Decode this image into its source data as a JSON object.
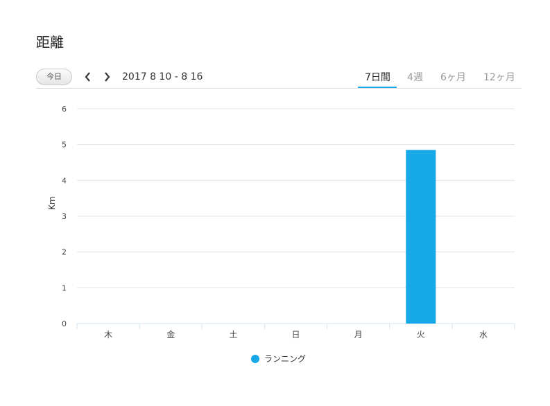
{
  "header": {
    "title": "距離"
  },
  "toolbar": {
    "today_label": "今日",
    "date_range": "2017 8 10 - 8 16",
    "tabs": [
      {
        "label": "7日間",
        "active": true
      },
      {
        "label": "4週",
        "active": false
      },
      {
        "label": "6ヶ月",
        "active": false
      },
      {
        "label": "12ヶ月",
        "active": false
      }
    ]
  },
  "icons": {
    "prev": "chevron-left-icon",
    "next": "chevron-right-icon"
  },
  "colors": {
    "bar": "#17a8e8",
    "accent": "#1aa9e8"
  },
  "chart_data": {
    "type": "bar",
    "categories": [
      "木",
      "金",
      "土",
      "日",
      "月",
      "火",
      "水"
    ],
    "series": [
      {
        "name": "ランニング",
        "values": [
          0,
          0,
          0,
          0,
          0,
          4.85,
          0
        ]
      }
    ],
    "ylabel": "Km",
    "xlabel": "",
    "ylim": [
      0,
      6
    ],
    "yticks": [
      "0",
      "1",
      "2",
      "3",
      "4",
      "5",
      "6"
    ],
    "grid": true,
    "legend": "bottom"
  }
}
